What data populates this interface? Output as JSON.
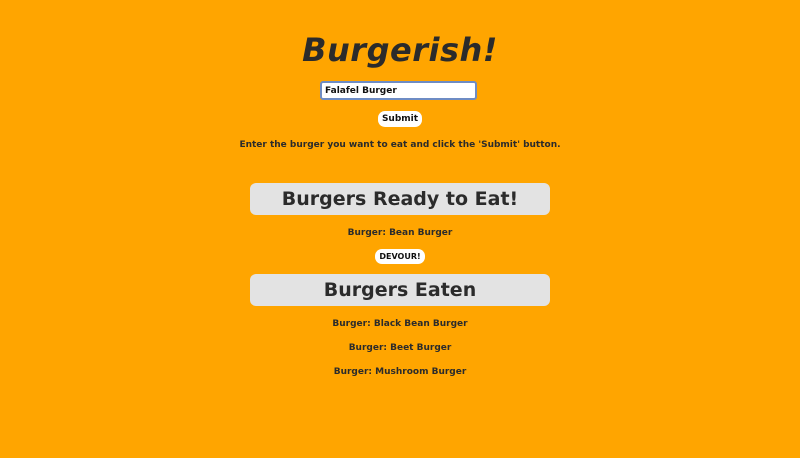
{
  "app": {
    "title": "Burgerish!",
    "instructions": "Enter the burger you want to eat and click the 'Submit' button."
  },
  "form": {
    "input_value": "Falafel Burger",
    "submit_label": "Submit"
  },
  "ready": {
    "heading": "Burgers Ready to Eat!",
    "items": [
      {
        "label": "Burger: Bean Burger",
        "action_label": "DEVOUR!"
      }
    ]
  },
  "eaten": {
    "heading": "Burgers Eaten",
    "items": [
      {
        "label": "Burger: Black Bean Burger"
      },
      {
        "label": "Burger: Beet Burger"
      },
      {
        "label": "Burger: Mushroom Burger"
      }
    ]
  },
  "colors": {
    "background": "#FFA500",
    "panel": "#E3E3E3",
    "text": "#2B2B2B",
    "button": "#FFFFFF"
  }
}
